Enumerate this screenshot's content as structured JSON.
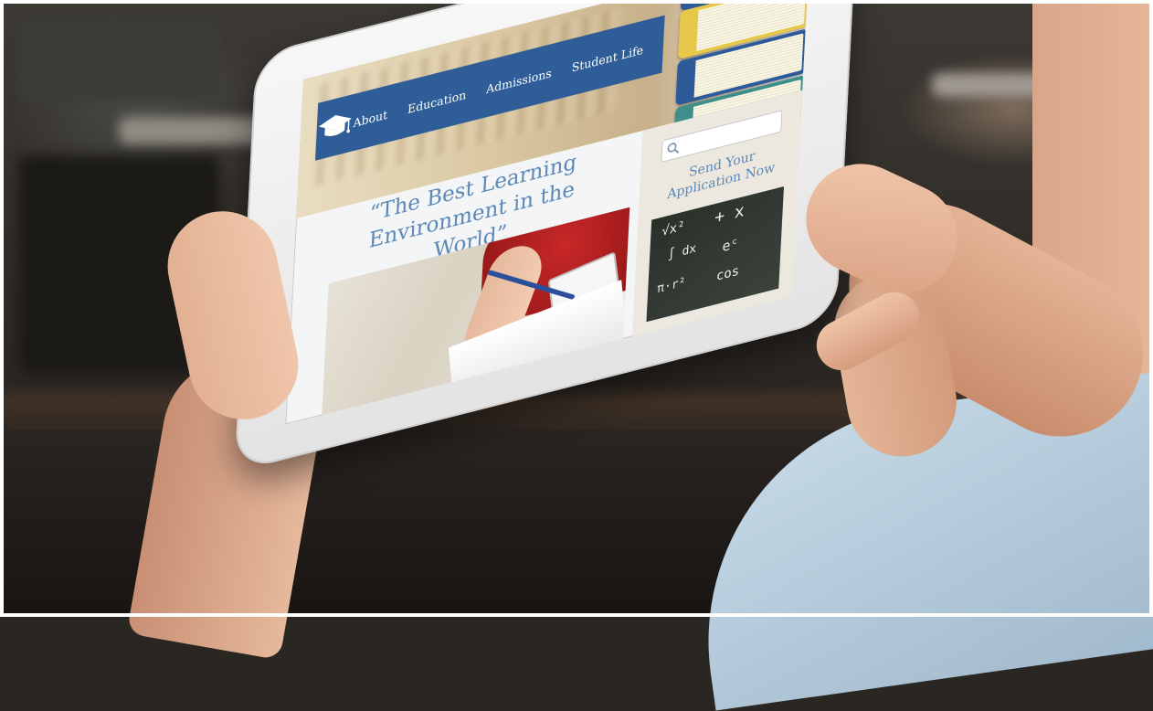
{
  "site": {
    "nav": {
      "items": [
        "About",
        "Education",
        "Admissions",
        "Student Life"
      ]
    },
    "headline": "“The Best Learning Environment in the World”",
    "search": {
      "placeholder": ""
    },
    "cta_line1": "Send Your",
    "cta_line2": "Application Now"
  },
  "colors": {
    "nav_background": "#2e5d98",
    "accent_text": "#5b88b8"
  },
  "icons": {
    "logo": "graduation-cap-icon",
    "search": "search-icon"
  }
}
